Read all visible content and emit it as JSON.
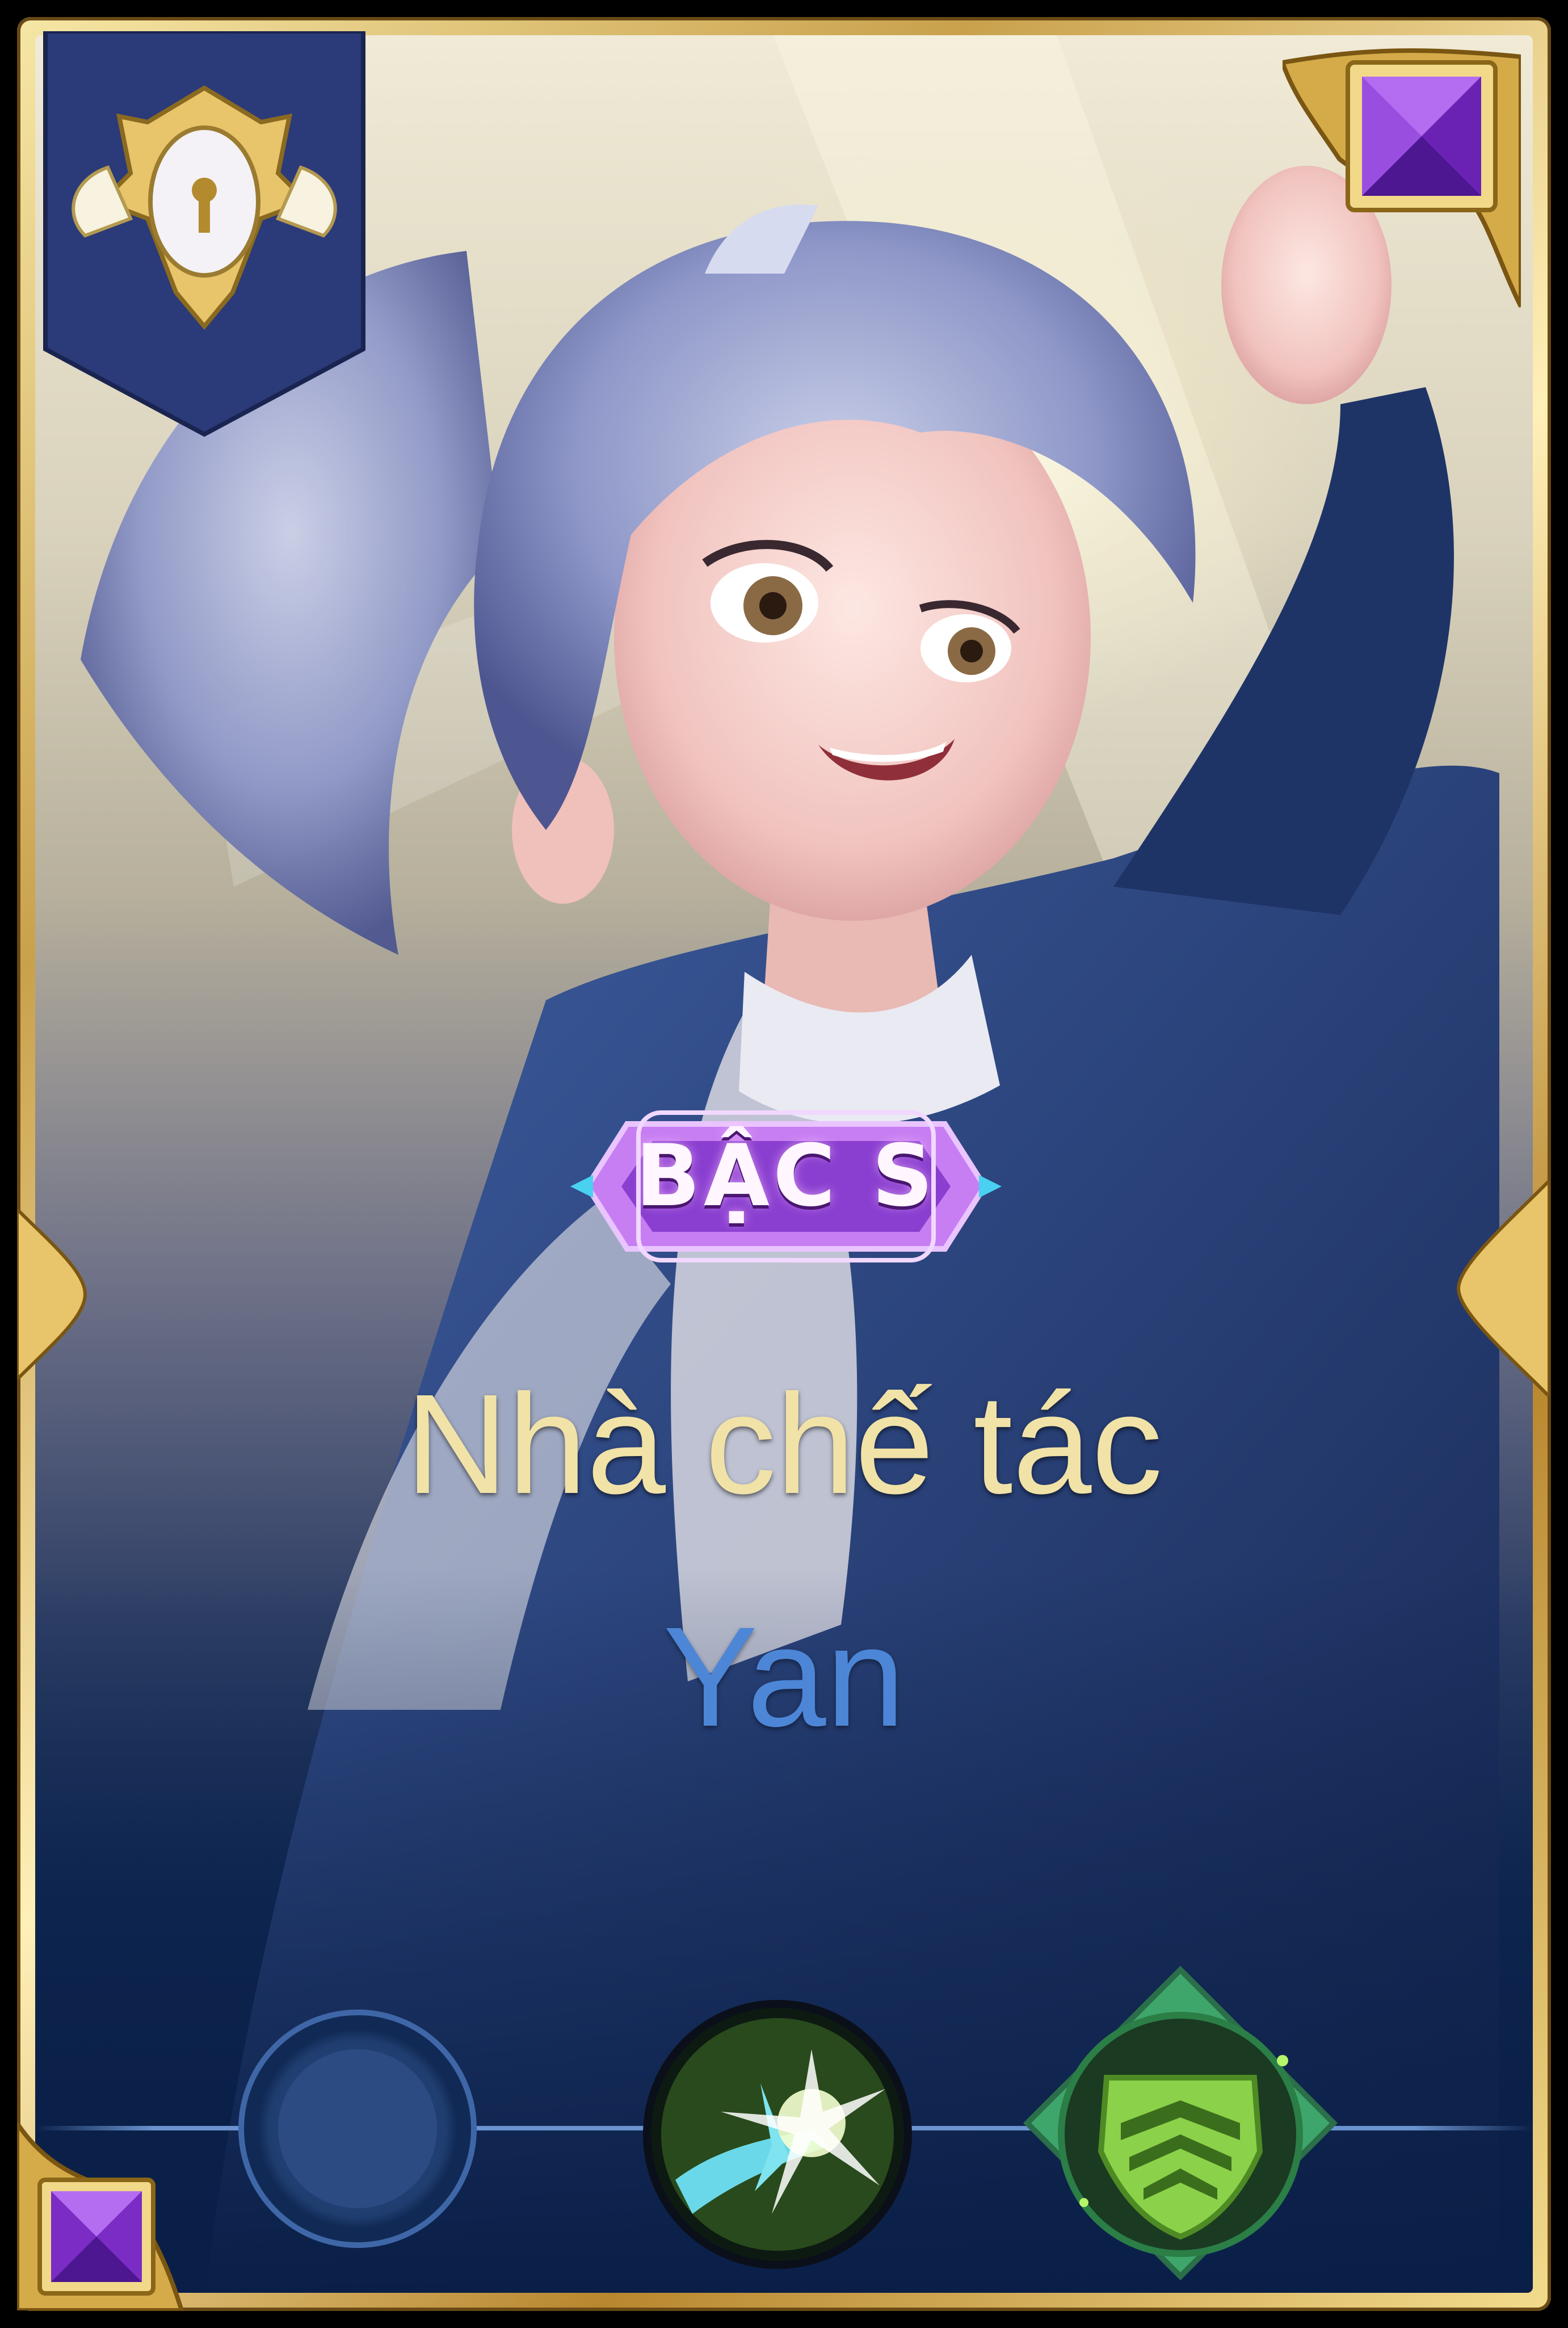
{
  "card": {
    "tier_label": "BẬC S",
    "skin_name": "Nhà chế tác",
    "hero_name": "Yan"
  },
  "colors": {
    "frame_gold": "#d4ad55",
    "tier_purple": "#8a3fd0",
    "skin_name_color": "#f1e2a8",
    "hero_name_color": "#4d86d6",
    "bottom_navy": "#0a1f47"
  },
  "icons": {
    "rank": "rank-emblem-icon",
    "gem_top": "purple-gem-icon",
    "gem_bottom": "purple-gem-icon",
    "skill_1": "empty-skill-slot",
    "skill_2": "strike-skill-icon",
    "skill_3": "shield-skill-icon"
  }
}
